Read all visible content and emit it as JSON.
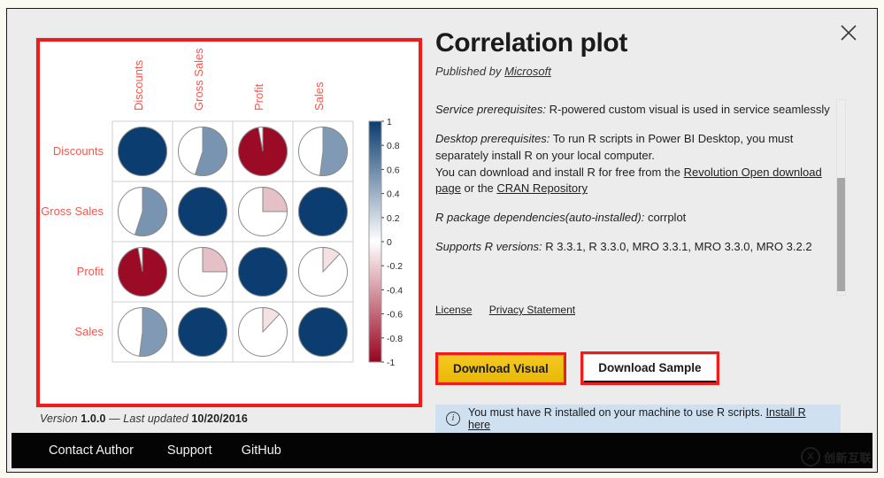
{
  "window": {
    "close_icon": "close-icon"
  },
  "preview": {
    "border_color": "#ee1c1c",
    "version_prefix": "Version",
    "version": "1.0.0",
    "separator": "—",
    "updated_prefix": "Last updated",
    "updated": "10/20/2016"
  },
  "details": {
    "title": "Correlation plot",
    "published_prefix": "Published by",
    "publisher": "Microsoft",
    "paragraphs": [
      {
        "label": "Service prerequisites:",
        "text": " R-powered custom visual is used in service seamlessly"
      },
      {
        "label": "Desktop prerequisites:",
        "text": " To run R scripts in Power BI Desktop, you must separately install R on your local computer."
      },
      {
        "label": "",
        "text": "You can download and install R for free from the "
      },
      {
        "label": "R package dependencies(auto-installed):",
        "text": " corrplot"
      },
      {
        "label": "Supports R versions:",
        "text": " R 3.3.1, R 3.3.0, MRO 3.3.1, MRO 3.3.0, MRO 3.2.2"
      }
    ],
    "link_revolution": "Revolution Open download page",
    "link_or": " or the ",
    "link_cran": "CRAN Repository",
    "links": {
      "license": "License",
      "privacy": "Privacy Statement"
    },
    "buttons": {
      "download_visual": "Download Visual",
      "download_sample": "Download Sample",
      "visual_fill": "#f0bf10",
      "highlight_border": "#ee1c1c"
    },
    "infobar": {
      "icon": "info-icon",
      "text": "You must have R installed on your machine to use R scripts. ",
      "link": "Install R here",
      "background": "#cfe0f0"
    }
  },
  "footer": {
    "items": [
      {
        "label": "Contact Author"
      },
      {
        "label": "Support"
      },
      {
        "label": "GitHub"
      }
    ],
    "background": "#040404"
  },
  "watermark": {
    "mark": "X",
    "text": "创新互联"
  },
  "chart_data": {
    "type": "heatmap",
    "title": "",
    "subtype": "correlation-matrix-pie",
    "categories": [
      "Discounts",
      "Gross Sales",
      "Profit",
      "Sales"
    ],
    "row_labels": [
      "Discounts",
      "Gross Sales",
      "Profit",
      "Sales"
    ],
    "col_labels": [
      "Discounts",
      "Gross Sales",
      "Profit",
      "Sales"
    ],
    "label_color": "#f2584f",
    "matrix": [
      [
        1.0,
        0.55,
        -0.97,
        0.52
      ],
      [
        0.55,
        1.0,
        -0.25,
        1.0
      ],
      [
        -0.97,
        -0.25,
        1.0,
        -0.12
      ],
      [
        0.52,
        1.0,
        -0.12,
        1.0
      ]
    ],
    "colorbar": {
      "ticks": [
        "1",
        "0.8",
        "0.6",
        "0.4",
        "0.2",
        "0",
        "-0.2",
        "-0.4",
        "-0.6",
        "-0.8",
        "-1"
      ],
      "min": -1,
      "max": 1,
      "high_color": "#0b3d70",
      "mid_color": "#ffffff",
      "low_color": "#99031f",
      "position": "right"
    },
    "grid": true,
    "xlabel": "",
    "ylabel": ""
  }
}
